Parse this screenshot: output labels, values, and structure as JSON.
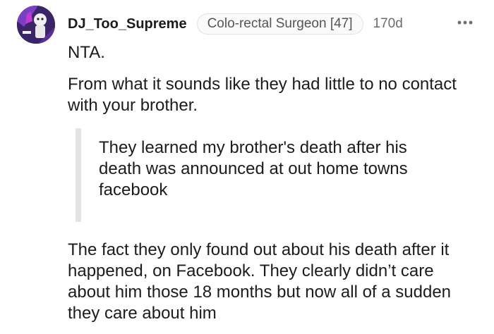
{
  "comment": {
    "author": "DJ_Too_Supreme",
    "flair": "Colo-rectal Surgeon [47]",
    "age": "170d",
    "avatar_icon": "user-avatar-icon",
    "more_icon": "more-options-icon",
    "paragraphs": {
      "first": "NTA.",
      "second": "From what it sounds like they had little to no contact with your brother.",
      "quote": "They learned my brother's death after his death was announced at out home towns facebook",
      "last": "The fact they only found out about his death after it happened, on Facebook. They clearly didn’t care about him those 18 months but now all of a sudden they care about him"
    }
  }
}
